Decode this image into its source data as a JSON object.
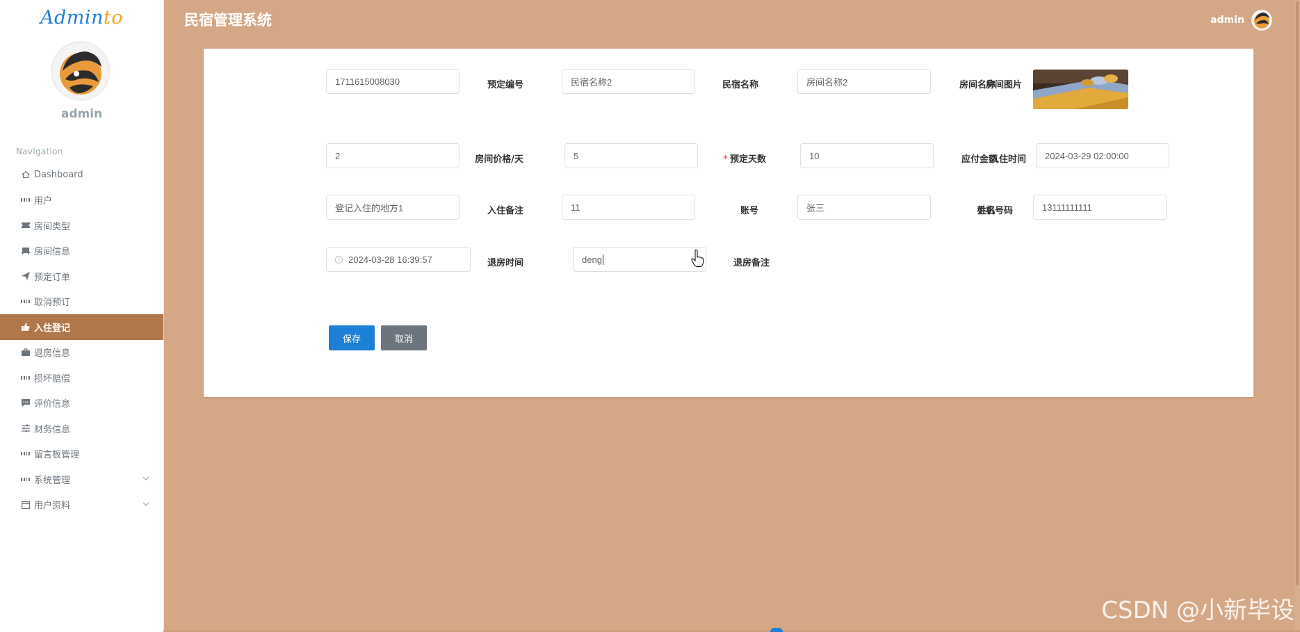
{
  "app": {
    "logo_main": "Admin",
    "logo_accent": "to",
    "header_title": "民宿管理系统",
    "user_name": "admin"
  },
  "sidebar": {
    "user_name": "admin",
    "nav_heading": "Navigation",
    "items": [
      {
        "label": "Dashboard",
        "icon": "home-icon"
      },
      {
        "label": "用户",
        "icon": "grid-icon"
      },
      {
        "label": "房间类型",
        "icon": "ticket-icon"
      },
      {
        "label": "房间信息",
        "icon": "bed-icon"
      },
      {
        "label": "预定订单",
        "icon": "send-icon"
      },
      {
        "label": "取消预订",
        "icon": "grid-icon"
      },
      {
        "label": "入住登记",
        "icon": "thumbs-up-icon",
        "active": true
      },
      {
        "label": "退房信息",
        "icon": "briefcase-icon"
      },
      {
        "label": "损坏赔偿",
        "icon": "grid-icon"
      },
      {
        "label": "评价信息",
        "icon": "comment-icon"
      },
      {
        "label": "财务信息",
        "icon": "sliders-icon"
      },
      {
        "label": "留言板管理",
        "icon": "grid-icon"
      },
      {
        "label": "系统管理",
        "icon": "grid-icon",
        "expandable": true
      },
      {
        "label": "用户资料",
        "icon": "calendar-icon",
        "expandable": true
      }
    ]
  },
  "form": {
    "booking_no": {
      "label": "预定编号",
      "value": "1711615008030"
    },
    "homestay_name": {
      "label": "民宿名称",
      "value": "民宿名称2"
    },
    "room_name": {
      "label": "房间名称",
      "value": "房间名称2"
    },
    "room_image": {
      "label": "房间图片"
    },
    "room_price": {
      "label": "房间价格/天",
      "value": "2"
    },
    "booking_days": {
      "label": "预定天数",
      "value": "5",
      "required": "*"
    },
    "amount_due": {
      "label": "应付金额",
      "value": "10"
    },
    "checkin_time": {
      "label": "入住时间",
      "value": "2024-03-29 02:00:00"
    },
    "checkin_note": {
      "label": "入住备注",
      "value": "登记入住的地方1"
    },
    "account": {
      "label": "账号",
      "value": "11"
    },
    "name": {
      "label": "姓名",
      "value": "张三"
    },
    "phone": {
      "label": "手机号码",
      "value": "13111111111"
    },
    "checkout_time": {
      "label": "退房时间",
      "value": "2024-03-28 16:39:57"
    },
    "checkout_note": {
      "label": "退房备注",
      "value": "deng"
    }
  },
  "buttons": {
    "save": "保存",
    "cancel": "取消"
  },
  "watermark": "CSDN @小新毕设",
  "colors": {
    "background": "#d4a786",
    "active_nav": "#b0774a",
    "primary": "#1e7fd6",
    "secondary": "#6c757d"
  }
}
